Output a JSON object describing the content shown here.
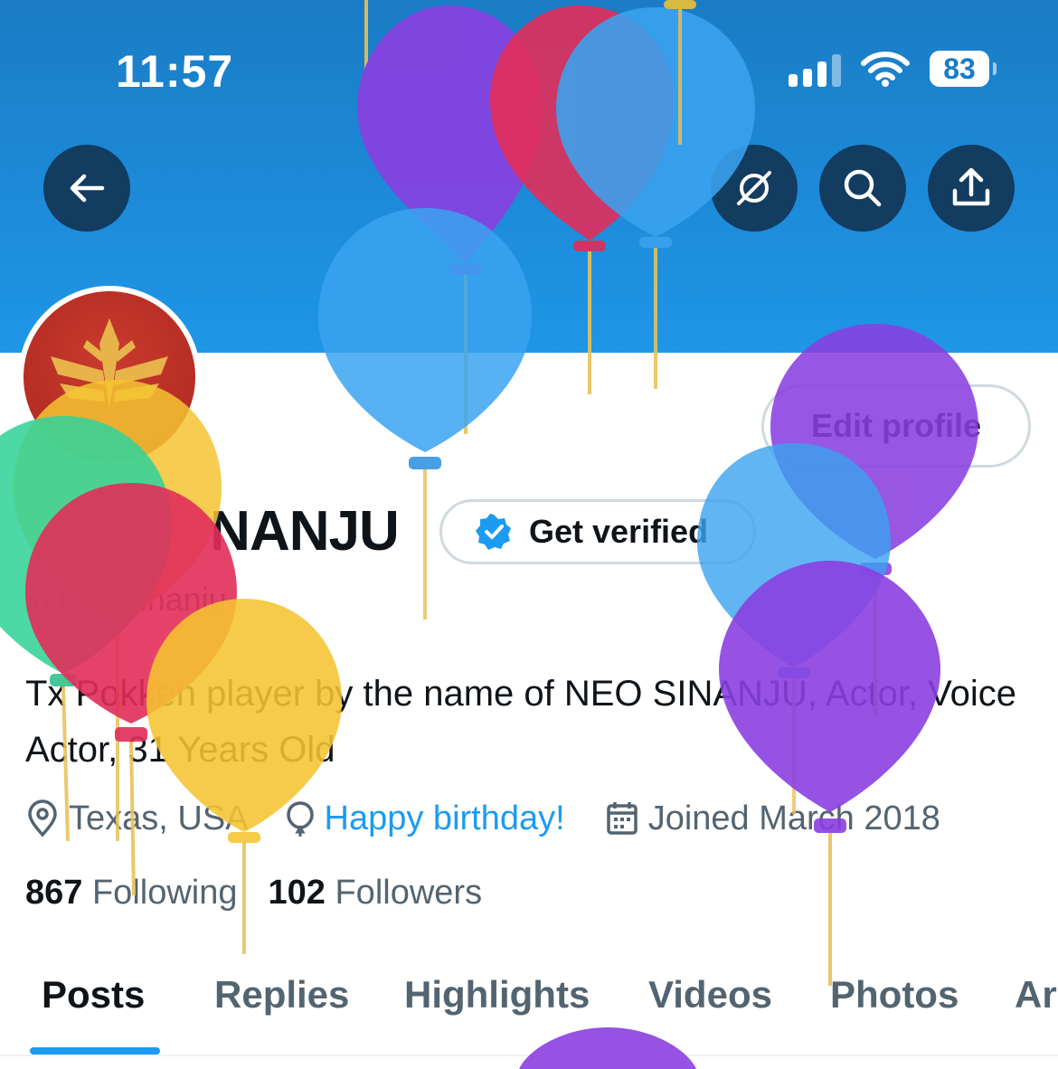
{
  "status_bar": {
    "time": "11:57",
    "battery": "83"
  },
  "profile": {
    "display_name": "NEO SINANJU",
    "display_name_visible": "NANJU",
    "handle": "@NeoSinanju",
    "bio": "Tx Pokken player by the name of NEO SINANJU, Actor, Voice Actor, 31 Years Old",
    "location": "Texas, USA",
    "birthday": "Happy birthday!",
    "joined": "Joined March 2018",
    "following_count": "867",
    "following_label": "Following",
    "followers_count": "102",
    "followers_label": "Followers"
  },
  "buttons": {
    "edit_profile": "Edit profile",
    "get_verified": "Get verified"
  },
  "tabs": [
    "Posts",
    "Replies",
    "Highlights",
    "Videos",
    "Photos",
    "Ar"
  ],
  "active_tab": "Posts",
  "icons": {
    "header": [
      "back-arrow-icon",
      "no-broadcast-icon",
      "search-icon",
      "share-icon"
    ],
    "meta": [
      "location-pin-icon",
      "balloon-icon",
      "calendar-icon"
    ],
    "verified": "verified-badge-icon"
  },
  "colors": {
    "banner": "#1d8ad9",
    "accent": "#1d9bf0",
    "header_button": "#123c60",
    "avatar_background": "#b62d23",
    "avatar_emblem": "#e8b34a",
    "text_primary": "#0f1419",
    "text_secondary": "#536471"
  }
}
